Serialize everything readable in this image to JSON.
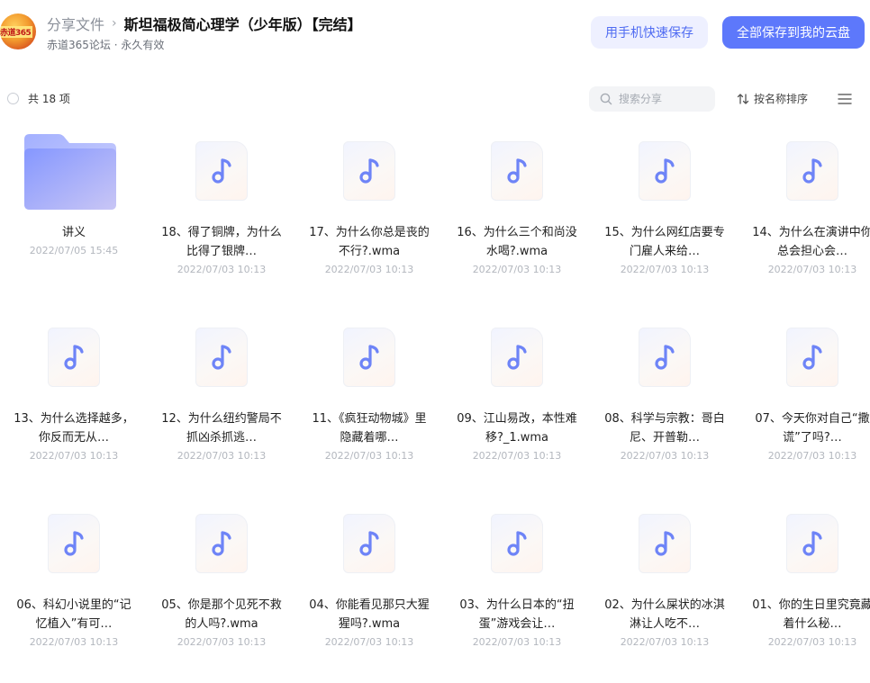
{
  "header": {
    "avatar_text": "赤道365",
    "breadcrumb_root": "分享文件",
    "breadcrumb_sep": "›",
    "title": "斯坦福极简心理学（少年版）【完结】",
    "subline": "赤道365论坛 · 永久有效",
    "mobile_save_label": "用手机快速保存",
    "save_all_label": "全部保存到我的云盘"
  },
  "toolbar": {
    "count_label": "共 18 项",
    "search_placeholder": "搜索分享",
    "sort_label": "按名称排序"
  },
  "colors": {
    "primary": "#5d78fb",
    "primary_light": "#eef0ff",
    "folder": "#8d9cff",
    "audio_note": "#6e84f7"
  },
  "items": [
    {
      "name": "讲义",
      "date": "2022/07/05 15:45",
      "type": "folder"
    },
    {
      "name": "18、得了铜牌，为什么比得了银牌…",
      "date": "2022/07/03 10:13",
      "type": "audio"
    },
    {
      "name": "17、为什么你总是丧的不行?.wma",
      "date": "2022/07/03 10:13",
      "type": "audio"
    },
    {
      "name": "16、为什么三个和尚没水喝?.wma",
      "date": "2022/07/03 10:13",
      "type": "audio"
    },
    {
      "name": "15、为什么网红店要专门雇人来给…",
      "date": "2022/07/03 10:13",
      "type": "audio"
    },
    {
      "name": "14、为什么在演讲中你总会担心会…",
      "date": "2022/07/03 10:13",
      "type": "audio"
    },
    {
      "name": "13、为什么选择越多，你反而无从…",
      "date": "2022/07/03 10:13",
      "type": "audio"
    },
    {
      "name": "12、为什么纽约警局不抓凶杀抓逃…",
      "date": "2022/07/03 10:13",
      "type": "audio"
    },
    {
      "name": "11、《疯狂动物城》里隐藏着哪…",
      "date": "2022/07/03 10:13",
      "type": "audio"
    },
    {
      "name": "09、江山易改，本性难移?_1.wma",
      "date": "2022/07/03 10:13",
      "type": "audio"
    },
    {
      "name": "08、科学与宗教：哥白尼、开普勒…",
      "date": "2022/07/03 10:13",
      "type": "audio"
    },
    {
      "name": "07、今天你对自己“撒谎”了吗?…",
      "date": "2022/07/03 10:13",
      "type": "audio"
    },
    {
      "name": "06、科幻小说里的“记忆植入”有可…",
      "date": "2022/07/03 10:13",
      "type": "audio"
    },
    {
      "name": "05、你是那个见死不救的人吗?.wma",
      "date": "2022/07/03 10:13",
      "type": "audio"
    },
    {
      "name": "04、你能看见那只大猩猩吗?.wma",
      "date": "2022/07/03 10:13",
      "type": "audio"
    },
    {
      "name": "03、为什么日本的“扭蛋”游戏会让…",
      "date": "2022/07/03 10:13",
      "type": "audio"
    },
    {
      "name": "02、为什么屎状的冰淇淋让人吃不…",
      "date": "2022/07/03 10:13",
      "type": "audio"
    },
    {
      "name": "01、你的生日里究竟藏着什么秘…",
      "date": "2022/07/03 10:13",
      "type": "audio"
    }
  ]
}
